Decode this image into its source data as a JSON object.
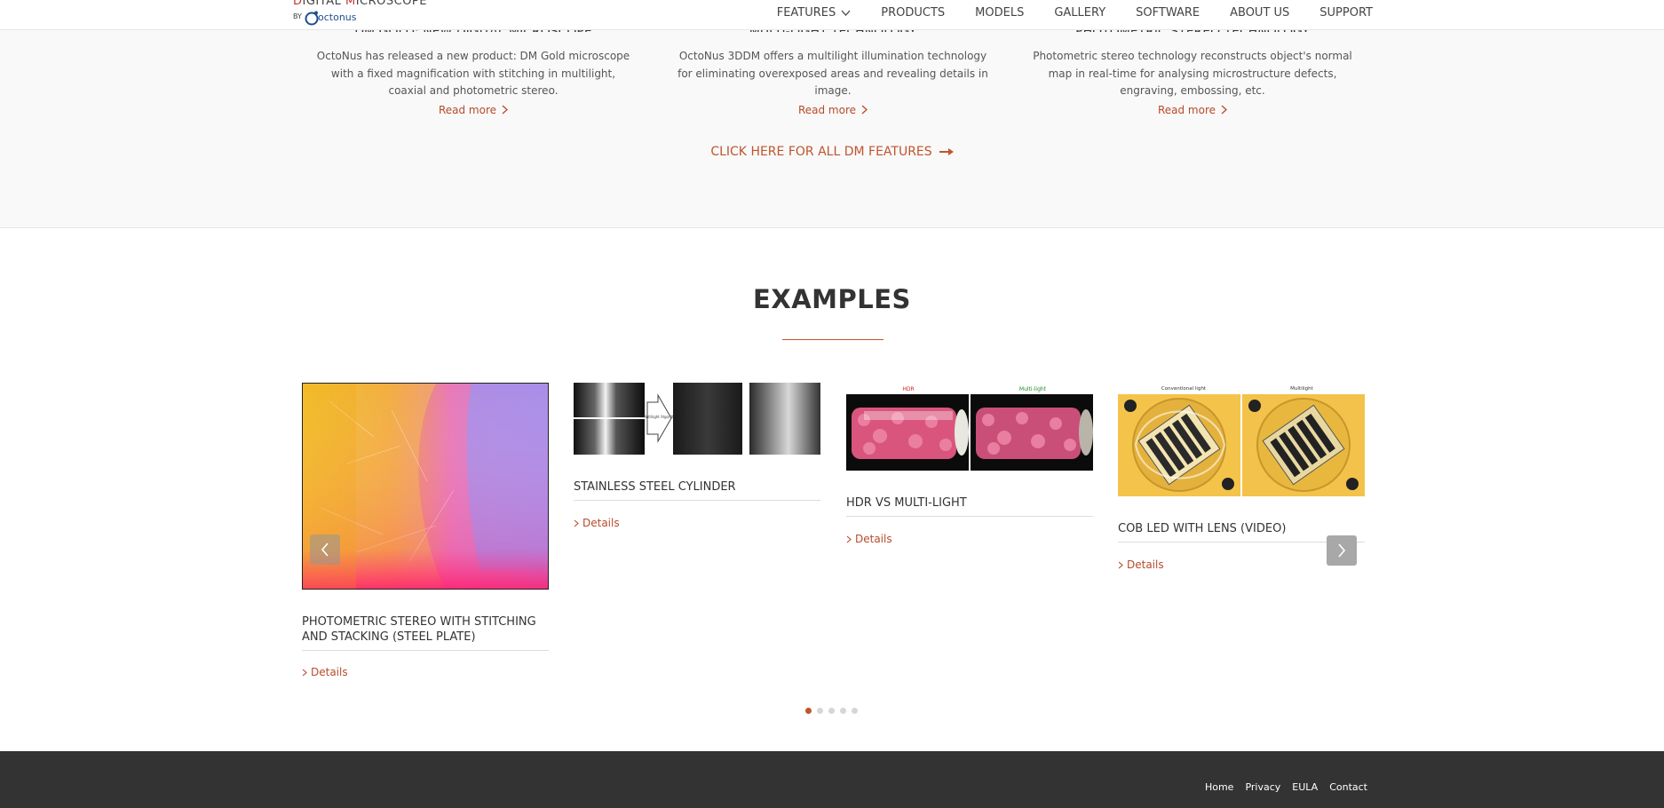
{
  "header": {
    "logo_line1_red1": "D",
    "logo_line1_a": "IGITAL ",
    "logo_line1_red2": "M",
    "logo_line1_b": "ICROSCOPE",
    "logo_by": "BY",
    "logo_brand": "octonus",
    "nav": [
      {
        "label": "FEATURES"
      },
      {
        "label": "PRODUCTS"
      },
      {
        "label": "MODELS"
      },
      {
        "label": "GALLERY"
      },
      {
        "label": "SOFTWARE"
      },
      {
        "label": "ABOUT US"
      },
      {
        "label": "SUPPORT"
      }
    ]
  },
  "features": {
    "items": [
      {
        "title": "DM GOLD: NEW DIGITAL MICROSCOPE",
        "text": "OctoNus has released a new product: DM Gold microscope with a fixed magnification with stitching in multilight, coaxial and photometric stereo.",
        "more": "Read more"
      },
      {
        "title": "MULTI-LIGHT TECHNOLOGY",
        "text": "OctoNus 3DDM offers a multilight illumination technology for eliminating overexposed areas and revealing details in image.",
        "more": "Read more"
      },
      {
        "title": "PHOTOMETRIC STEREO TECHNOLOGY",
        "text": "Photometric stereo technology reconstructs object's normal map in real-time for analysing microstructure defects, engraving, embossing, etc.",
        "more": "Read more"
      }
    ],
    "all_link": "CLICK HERE FOR ALL DM FEATURES"
  },
  "examples": {
    "title": "EXAMPLES",
    "cards": [
      {
        "title": "PHOTOMETRIC STEREO WITH STITCHING AND STACKING (STEEL PLATE)",
        "details": "Details"
      },
      {
        "title": "STAINLESS STEEL CYLINDER",
        "details": "Details",
        "img_caption": "Multilight Algorithm"
      },
      {
        "title": "HDR VS MULTI-LIGHT",
        "details": "Details",
        "img_label_left": "HDR",
        "img_label_right": "Multi-light"
      },
      {
        "title": "COB LED WITH LENS (VIDEO)",
        "details": "Details",
        "img_label_left": "Conventional light",
        "img_label_right": "Multilight"
      }
    ],
    "pager": {
      "count": 5,
      "active": 0
    }
  },
  "footer": {
    "links": [
      "Home",
      "Privacy",
      "EULA",
      "Contact"
    ]
  },
  "colors": {
    "accent": "#c0552e",
    "footer_bg": "#333333",
    "section_bg": "#f9f9f9"
  }
}
